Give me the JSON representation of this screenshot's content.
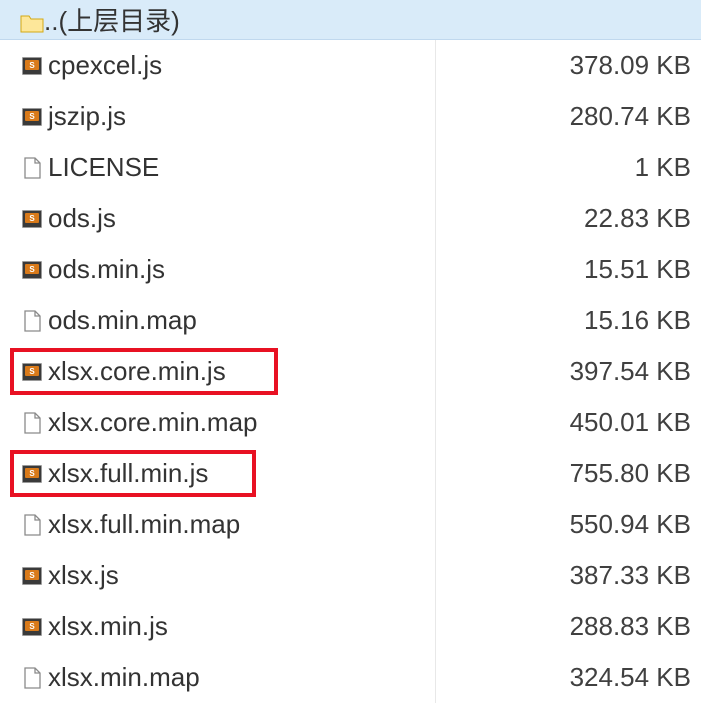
{
  "parent": {
    "label": "..(上层目录)"
  },
  "files": [
    {
      "name": "cpexcel.js",
      "size": "378.09 KB",
      "type": "js",
      "highlight": false
    },
    {
      "name": "jszip.js",
      "size": "280.74 KB",
      "type": "js",
      "highlight": false
    },
    {
      "name": "LICENSE",
      "size": "1 KB",
      "type": "file",
      "highlight": false
    },
    {
      "name": "ods.js",
      "size": "22.83 KB",
      "type": "js",
      "highlight": false
    },
    {
      "name": "ods.min.js",
      "size": "15.51 KB",
      "type": "js",
      "highlight": false
    },
    {
      "name": "ods.min.map",
      "size": "15.16 KB",
      "type": "file",
      "highlight": false
    },
    {
      "name": "xlsx.core.min.js",
      "size": "397.54 KB",
      "type": "js",
      "highlight": true,
      "hbClass": "hb1"
    },
    {
      "name": "xlsx.core.min.map",
      "size": "450.01 KB",
      "type": "file",
      "highlight": false
    },
    {
      "name": "xlsx.full.min.js",
      "size": "755.80 KB",
      "type": "js",
      "highlight": true,
      "hbClass": "hb2"
    },
    {
      "name": "xlsx.full.min.map",
      "size": "550.94 KB",
      "type": "file",
      "highlight": false
    },
    {
      "name": "xlsx.js",
      "size": "387.33 KB",
      "type": "js",
      "highlight": false
    },
    {
      "name": "xlsx.min.js",
      "size": "288.83 KB",
      "type": "js",
      "highlight": false
    },
    {
      "name": "xlsx.min.map",
      "size": "324.54 KB",
      "type": "file",
      "highlight": false
    }
  ]
}
